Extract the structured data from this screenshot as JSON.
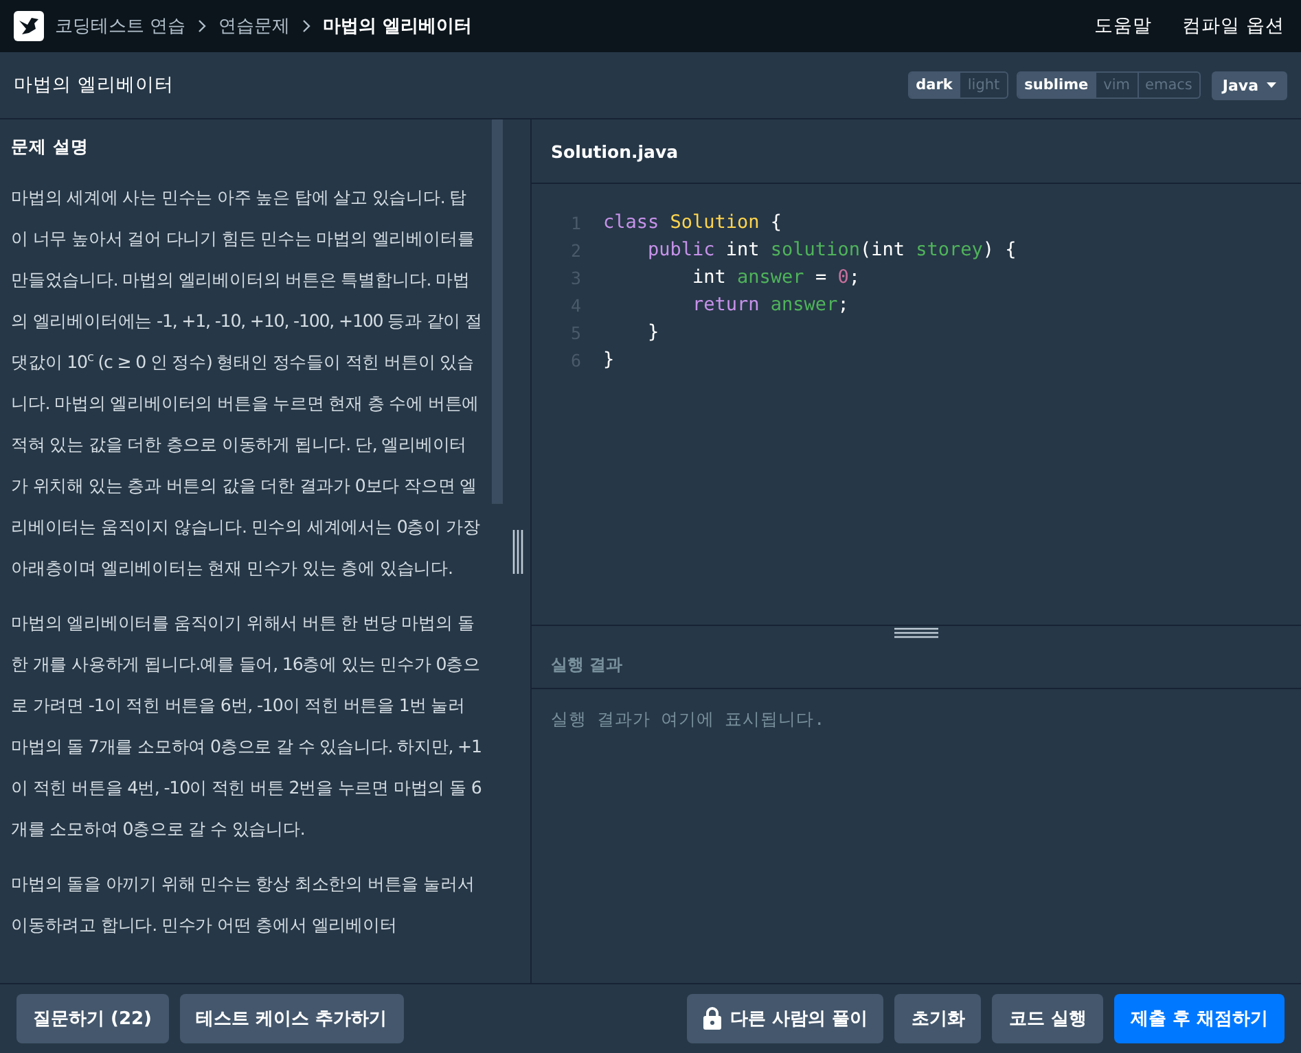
{
  "breadcrumb": [
    "코딩테스트 연습",
    "연습문제",
    "마법의 엘리베이터"
  ],
  "top_links": [
    "도움말",
    "컴파일 옵션"
  ],
  "problem_title": "마법의 엘리베이터",
  "themes": [
    {
      "label": "dark",
      "selected": true
    },
    {
      "label": "light",
      "selected": false
    }
  ],
  "keymaps": [
    {
      "label": "sublime",
      "selected": true
    },
    {
      "label": "vim",
      "selected": false
    },
    {
      "label": "emacs",
      "selected": false
    }
  ],
  "language": "Java",
  "description": {
    "heading": "문제 설명",
    "paragraphs": [
      "마법의 세계에 사는 민수는 아주 높은 탑에 살고 있습니다. 탑이 너무 높아서 걸어 다니기 힘든 민수는 마법의 엘리베이터를 만들었습니다. 마법의 엘리베이터의 버튼은 특별합니다. 마법의 엘리베이터에는 -1, +1, -10, +10, -100, +100 등과 같이 절댓값이 10$^{c}$ (c ≥ 0 인 정수) 형태인 정수들이 적힌 버튼이 있습니다. 마법의 엘리베이터의 버튼을 누르면 현재 층 수에 버튼에 적혀 있는 값을 더한 층으로 이동하게 됩니다. 단, 엘리베이터가 위치해 있는 층과 버튼의 값을 더한 결과가 0보다 작으면 엘리베이터는 움직이지 않습니다. 민수의 세계에서는 0층이 가장 아래층이며 엘리베이터는 현재 민수가 있는 층에 있습니다.",
      "마법의 엘리베이터를 움직이기 위해서 버튼 한 번당 마법의 돌 한 개를 사용하게 됩니다.예를 들어, 16층에 있는 민수가 0층으로 가려면 -1이 적힌 버튼을 6번, -10이 적힌 버튼을 1번 눌러 마법의 돌 7개를 소모하여 0층으로 갈 수 있습니다. 하지만, +1이 적힌 버튼을 4번, -10이 적힌 버튼 2번을 누르면 마법의 돌 6개를 소모하여 0층으로 갈 수 있습니다.",
      "마법의 돌을 아끼기 위해 민수는 항상 최소한의 버튼을 눌러서 이동하려고 합니다. 민수가 어떤 층에서 엘리베이터"
    ]
  },
  "editor": {
    "filename": "Solution.java",
    "lines": [
      {
        "number": "1",
        "tokens": [
          {
            "text": "class",
            "kind": "keyword"
          },
          {
            "text": " Solution",
            "kind": "type"
          },
          {
            "text": " {",
            "kind": "plain"
          }
        ]
      },
      {
        "number": "2",
        "tokens": [
          {
            "text": "    public",
            "kind": "keyword"
          },
          {
            "text": " int ",
            "kind": "plain"
          },
          {
            "text": "solution",
            "kind": "name"
          },
          {
            "text": "(int ",
            "kind": "plain"
          },
          {
            "text": "storey",
            "kind": "name"
          },
          {
            "text": ") {",
            "kind": "plain"
          }
        ]
      },
      {
        "number": "3",
        "tokens": [
          {
            "text": "        int ",
            "kind": "plain"
          },
          {
            "text": "answer",
            "kind": "name"
          },
          {
            "text": " = ",
            "kind": "plain"
          },
          {
            "text": "0",
            "kind": "number"
          },
          {
            "text": ";",
            "kind": "plain"
          }
        ]
      },
      {
        "number": "4",
        "tokens": [
          {
            "text": "        return",
            "kind": "keyword"
          },
          {
            "text": " answer",
            "kind": "name"
          },
          {
            "text": ";",
            "kind": "plain"
          }
        ]
      },
      {
        "number": "5",
        "tokens": [
          {
            "text": "    }",
            "kind": "plain"
          }
        ]
      },
      {
        "number": "6",
        "tokens": [
          {
            "text": "}",
            "kind": "plain"
          }
        ]
      }
    ]
  },
  "result": {
    "heading": "실행 결과",
    "placeholder": "실행 결과가 여기에 표시됩니다."
  },
  "footer_left": [
    {
      "label": "질문하기 (22)"
    },
    {
      "label": "테스트 케이스 추가하기"
    }
  ],
  "footer_right": [
    {
      "label": "다른 사람의 풀이",
      "kind": "locked"
    },
    {
      "label": "초기화",
      "kind": "plain"
    },
    {
      "label": "코드 실행",
      "kind": "plain"
    },
    {
      "label": "제출 후 채점하기",
      "kind": "primary"
    }
  ]
}
